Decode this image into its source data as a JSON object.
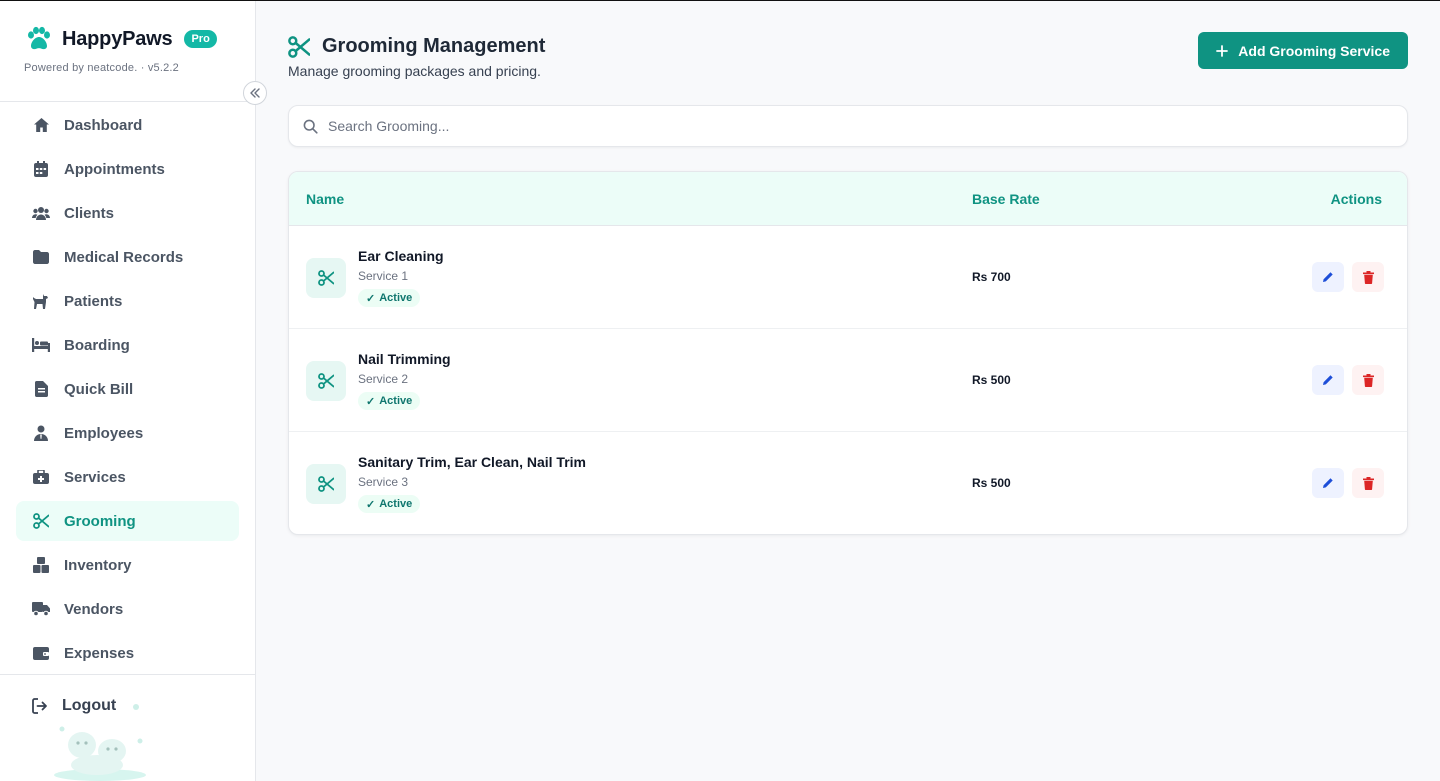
{
  "brand": {
    "name": "HappyPaws",
    "badge": "Pro",
    "powered_by": "Powered by neatcode. · v5.2.2"
  },
  "sidebar": {
    "items": [
      {
        "label": "Dashboard",
        "icon": "home-icon"
      },
      {
        "label": "Appointments",
        "icon": "calendar-icon"
      },
      {
        "label": "Clients",
        "icon": "users-icon"
      },
      {
        "label": "Medical Records",
        "icon": "folder-icon"
      },
      {
        "label": "Patients",
        "icon": "dog-icon"
      },
      {
        "label": "Boarding",
        "icon": "bed-icon"
      },
      {
        "label": "Quick Bill",
        "icon": "file-invoice-icon"
      },
      {
        "label": "Employees",
        "icon": "user-tie-icon"
      },
      {
        "label": "Services",
        "icon": "medkit-icon"
      },
      {
        "label": "Grooming",
        "icon": "scissors-icon",
        "active": true
      },
      {
        "label": "Inventory",
        "icon": "boxes-icon"
      },
      {
        "label": "Vendors",
        "icon": "truck-icon"
      },
      {
        "label": "Expenses",
        "icon": "wallet-icon"
      }
    ],
    "logout_label": "Logout"
  },
  "header": {
    "title": "Grooming Management",
    "subtitle": "Manage grooming packages and pricing.",
    "add_button": "Add Grooming Service"
  },
  "search": {
    "placeholder": "Search Grooming..."
  },
  "table": {
    "columns": {
      "name": "Name",
      "rate": "Base Rate",
      "actions": "Actions"
    },
    "rows": [
      {
        "name": "Ear Cleaning",
        "sub": "Service 1",
        "status": "Active",
        "rate": "Rs 700"
      },
      {
        "name": "Nail Trimming",
        "sub": "Service 2",
        "status": "Active",
        "rate": "Rs 500"
      },
      {
        "name": "Sanitary Trim, Ear Clean, Nail Trim",
        "sub": "Service 3",
        "status": "Active",
        "rate": "Rs 500"
      }
    ]
  },
  "colors": {
    "accent": "#0f9382",
    "brand_badge": "#14b8a6",
    "edit": "#1d4ed8",
    "delete": "#dc2626"
  }
}
